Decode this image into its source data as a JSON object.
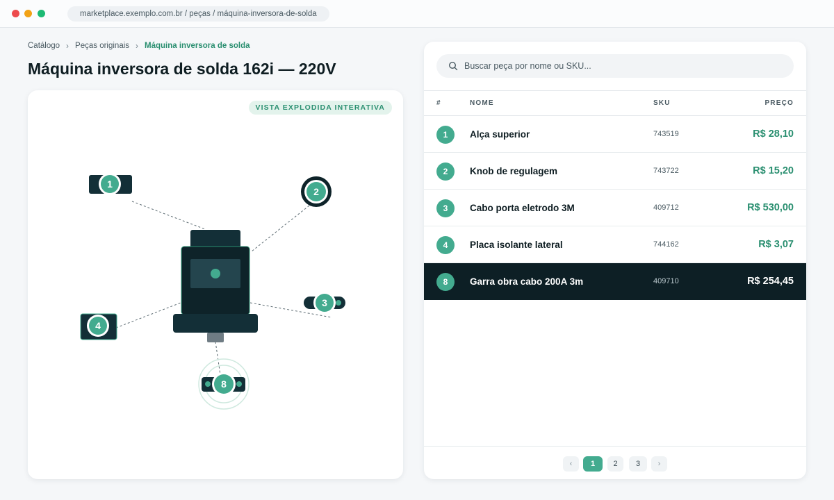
{
  "browser": {
    "url": "marketplace.exemplo.com.br / peças / máquina-inversora-de-solda"
  },
  "breadcrumb": {
    "items": [
      "Catálogo",
      "Peças originais",
      "Máquina inversora de solda"
    ],
    "separator": "›"
  },
  "page_title": "Máquina inversora de solda 162i — 220V",
  "diagram": {
    "badge": "VISTA EXPLODIDA INTERATIVA",
    "callouts": [
      "1",
      "2",
      "3",
      "4",
      "8"
    ],
    "selected_callout": "8"
  },
  "search": {
    "placeholder": "Buscar peça por nome ou SKU...",
    "icon": "search-icon"
  },
  "table": {
    "headers": {
      "num": "#",
      "name": "NOME",
      "sku": "SKU",
      "price": "PREÇO"
    },
    "rows": [
      {
        "num": "1",
        "name": "Alça superior",
        "sku": "743519",
        "price": "R$ 28,10",
        "selected": false
      },
      {
        "num": "2",
        "name": "Knob de regulagem",
        "sku": "743722",
        "price": "R$ 15,20",
        "selected": false
      },
      {
        "num": "3",
        "name": "Cabo porta eletrodo 3M",
        "sku": "409712",
        "price": "R$ 530,00",
        "selected": false
      },
      {
        "num": "4",
        "name": "Placa isolante lateral",
        "sku": "744162",
        "price": "R$ 3,07",
        "selected": false
      },
      {
        "num": "8",
        "name": "Garra obra cabo 200A 3m",
        "sku": "409710",
        "price": "R$ 254,45",
        "selected": true
      }
    ]
  },
  "pagination": {
    "prev": "‹",
    "pages": [
      "1",
      "2",
      "3"
    ],
    "current": "1",
    "next": "›"
  },
  "colors": {
    "accent": "#43ab8f",
    "accent_text": "#2a8f70",
    "dark": "#0d1f25",
    "machine_body": "#132f37"
  }
}
